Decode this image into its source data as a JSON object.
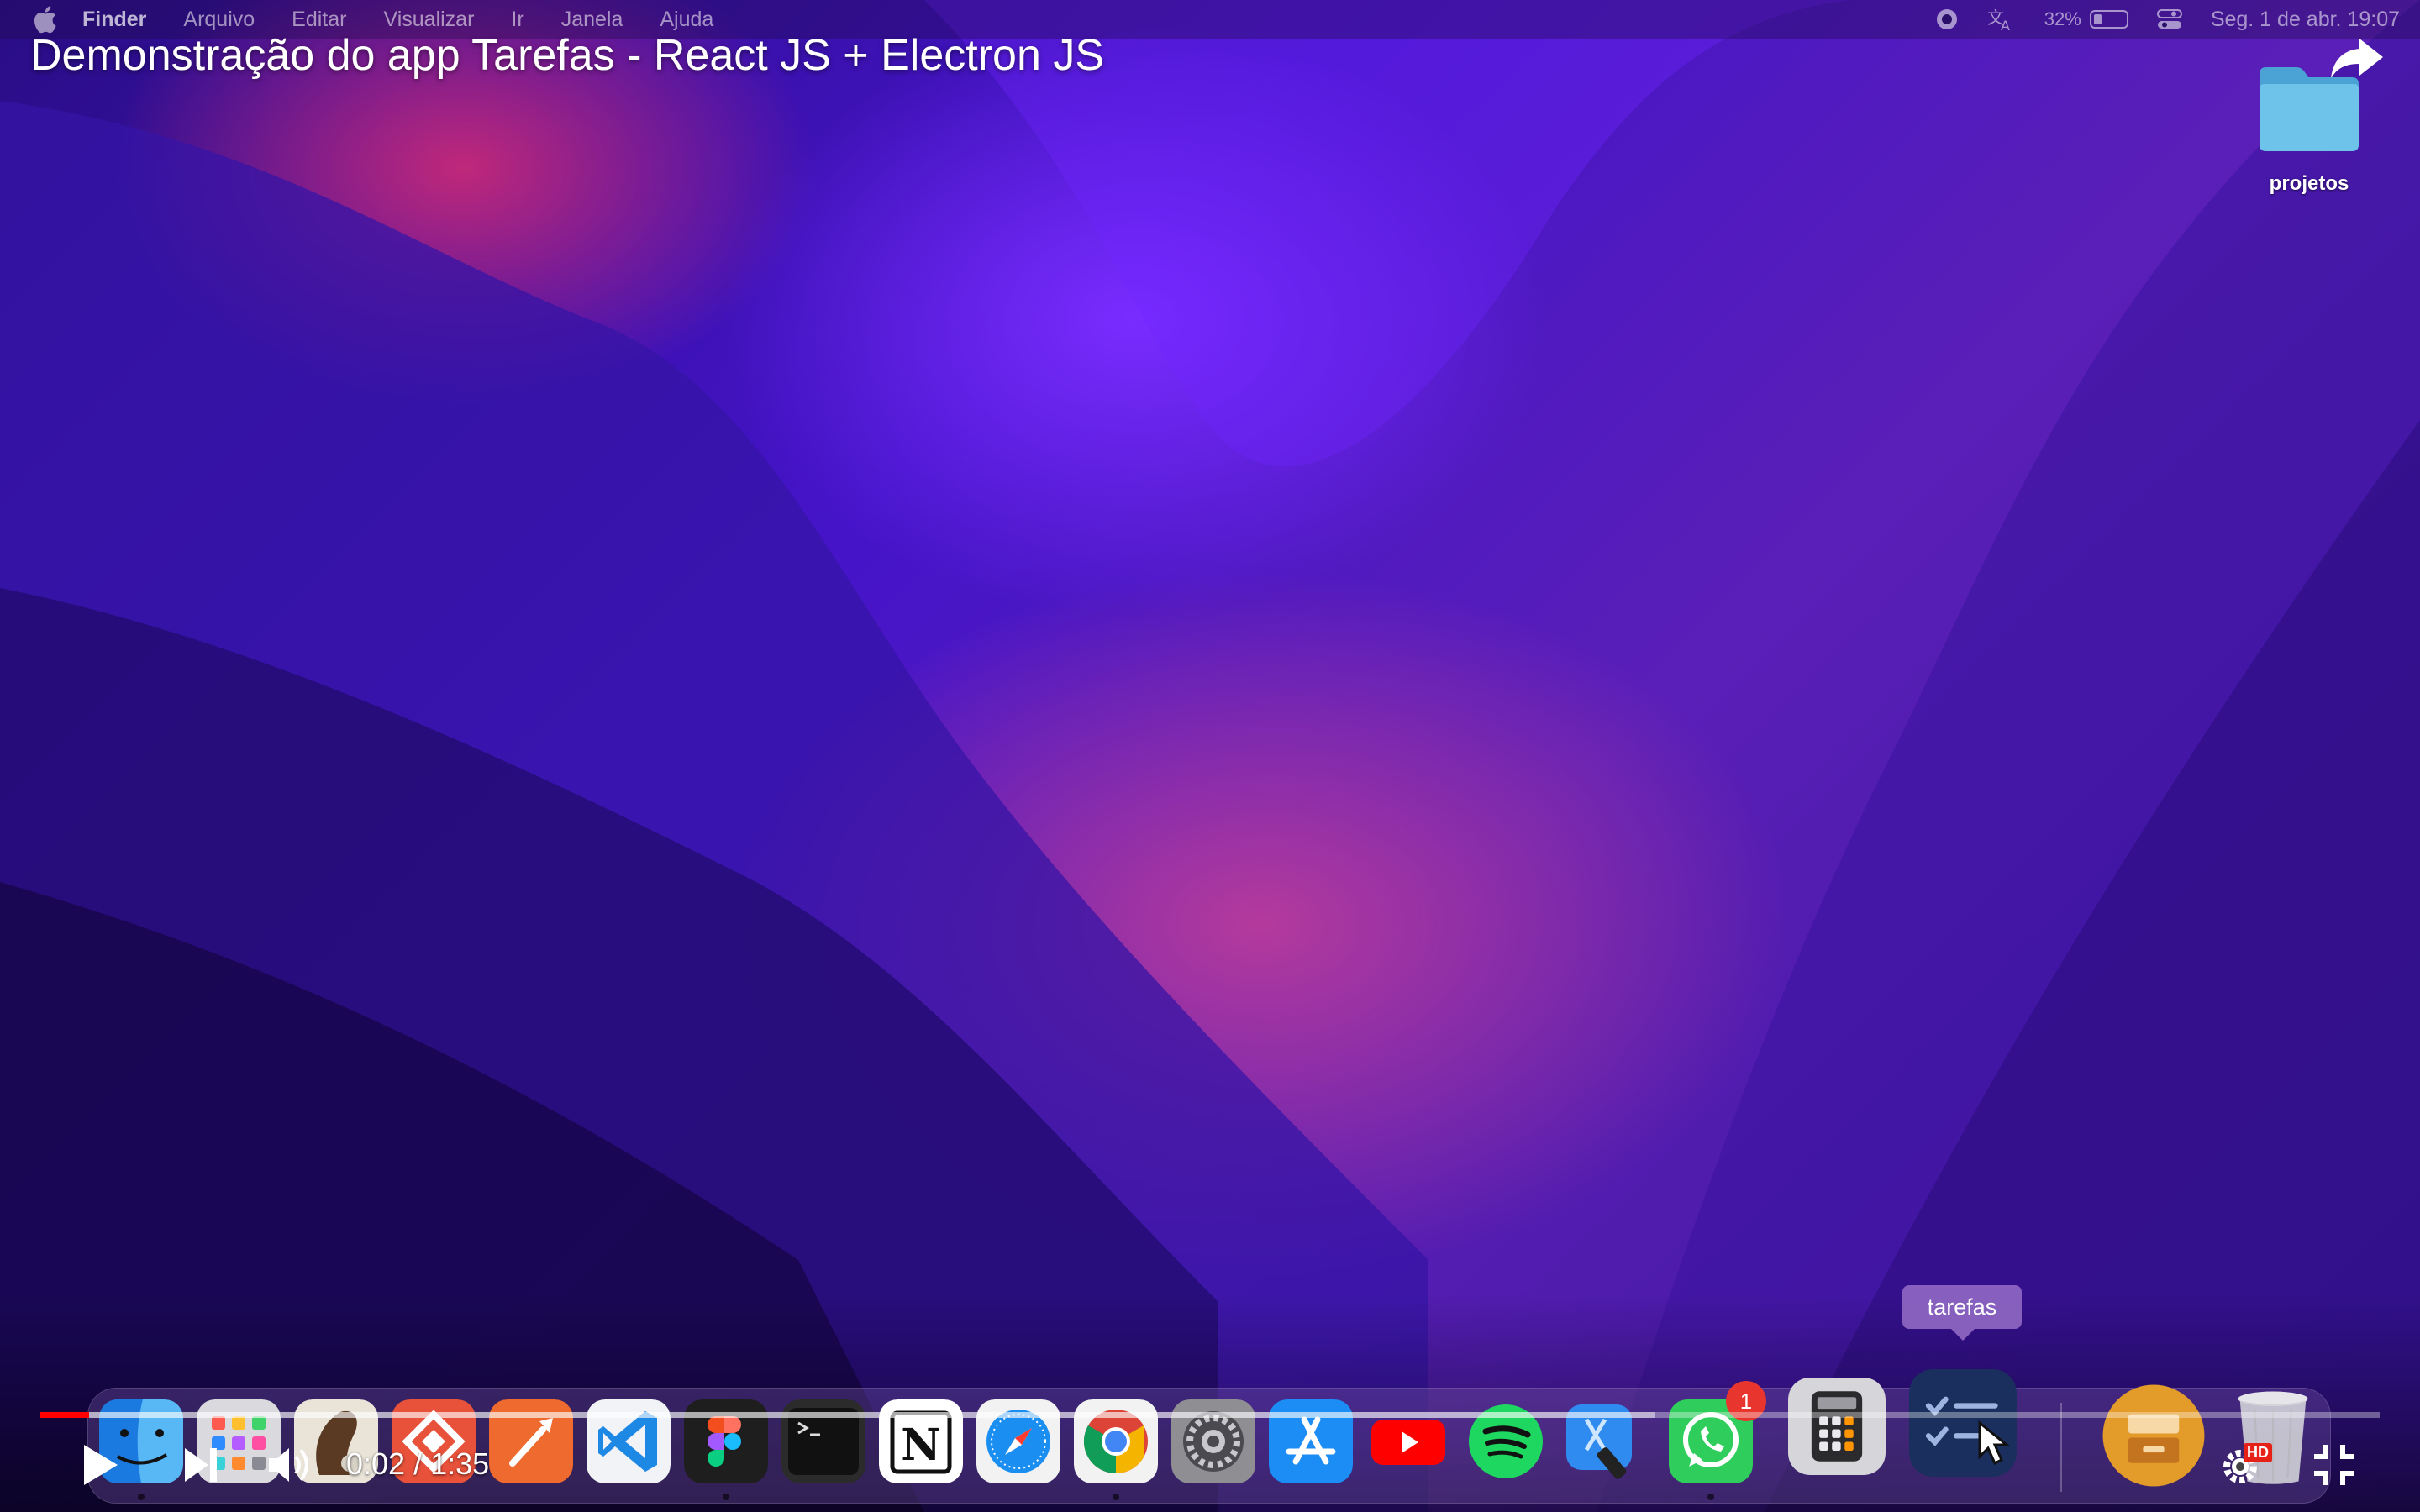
{
  "menubar": {
    "app_name": "Finder",
    "menus": [
      "Arquivo",
      "Editar",
      "Visualizar",
      "Ir",
      "Janela",
      "Ajuda"
    ],
    "battery_percent_label": "32%",
    "battery_level": 0.32,
    "datetime": "Seg. 1 de abr.  19:07"
  },
  "video": {
    "title": "Demonstração do app Tarefas - React JS + Electron JS",
    "time_current": "0:02",
    "time_separator": " / ",
    "time_total": "1:35",
    "played_fraction": 0.021,
    "loaded_fraction": 0.69,
    "quality_badge": "HD"
  },
  "desktop": {
    "folder_label": "projetos"
  },
  "dock": {
    "tooltip": "tarefas",
    "whatsapp_badge": "1",
    "notion_glyph": "N",
    "apps": [
      "finder",
      "launchpad",
      "sequel-pro",
      "anydesk",
      "postman",
      "vscode",
      "figma",
      "terminal",
      "notion",
      "safari",
      "chrome",
      "system-preferences",
      "app-store",
      "youtube",
      "spotify",
      "xcode",
      "whatsapp",
      "calculator",
      "tarefas",
      "archive-utility",
      "trash"
    ]
  },
  "colors": {
    "progress_played": "#ff0000",
    "tooltip_bg": "#9a6fd0",
    "badge_red": "#e8362f"
  }
}
